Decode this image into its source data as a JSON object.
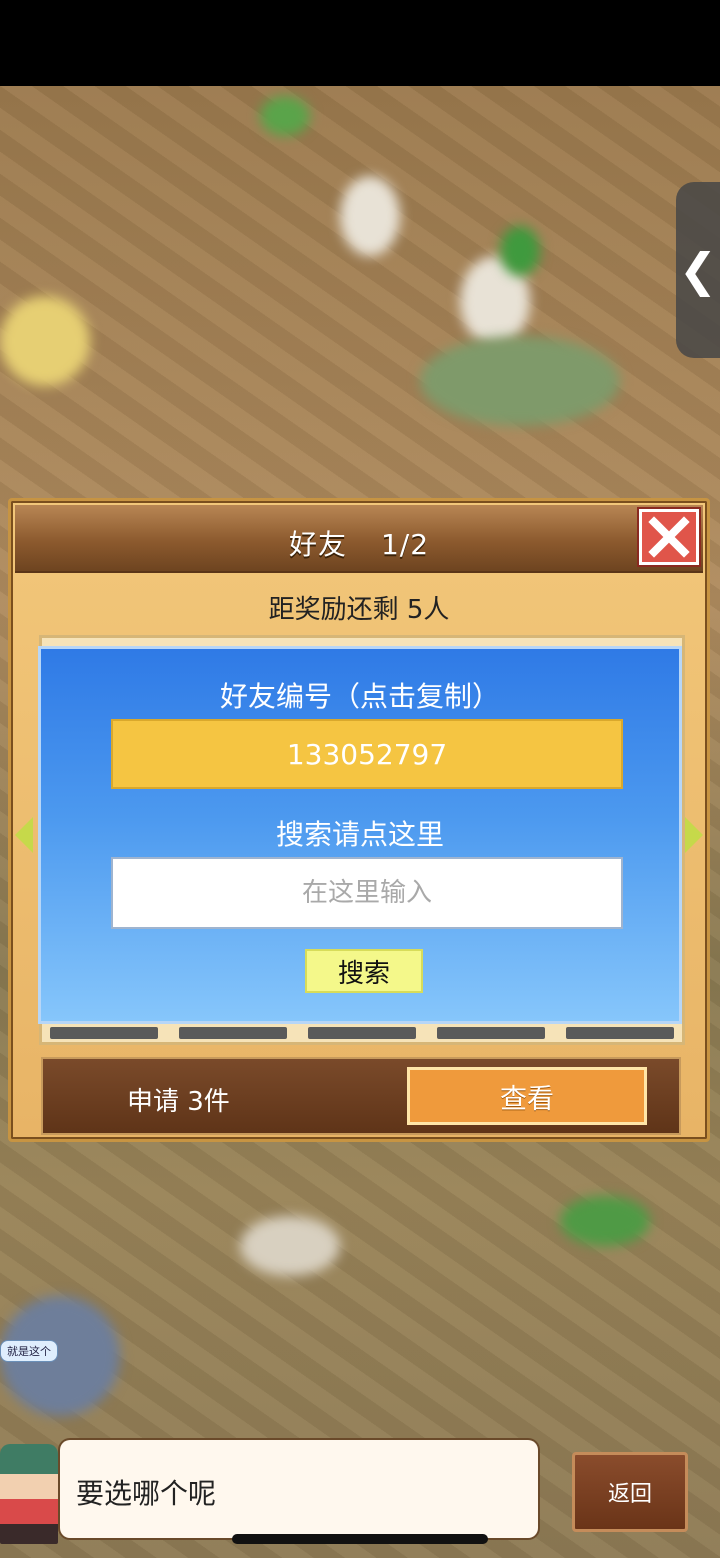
{
  "dialog": {
    "title": "好友",
    "page": "1/2",
    "reward_text": "距奖励还剩 5人"
  },
  "search_panel": {
    "id_label": "好友编号（点击复制）",
    "friend_id": "133052797",
    "search_label": "搜索请点这里",
    "search_placeholder": "在这里输入",
    "search_button": "搜索"
  },
  "requests": {
    "text": "申请 3件",
    "view_button": "查看"
  },
  "bottom": {
    "speech": "要选哪个呢",
    "back_button": "返回",
    "tag": "就是这个"
  },
  "side_tab": {
    "glyph": "❮"
  },
  "colors": {
    "accent_orange": "#ef9a3c",
    "id_yellow": "#f5c542",
    "panel_blue": "#2f7ae6",
    "close_red": "#e0554a"
  }
}
